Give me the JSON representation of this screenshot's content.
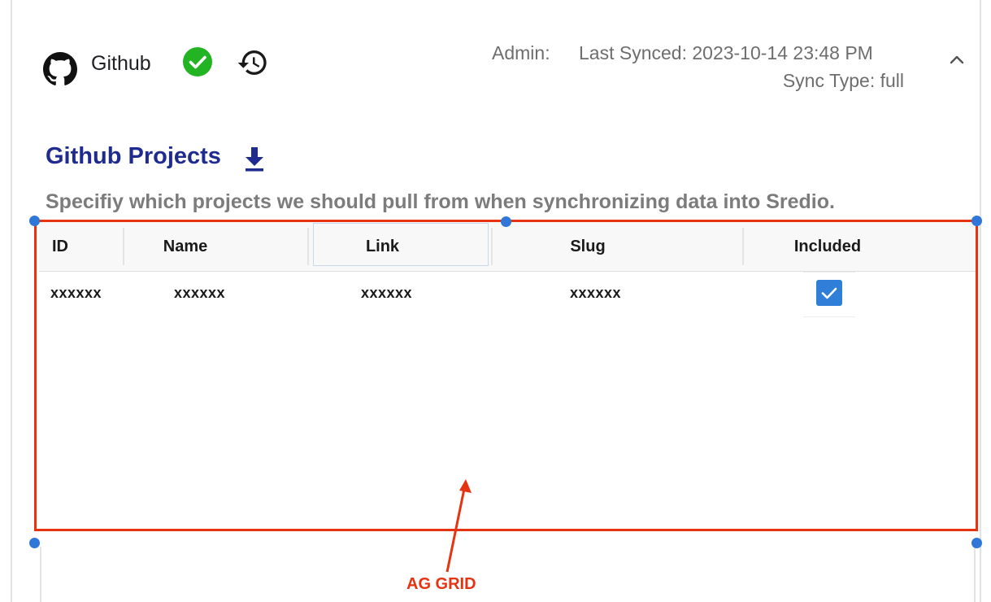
{
  "header": {
    "app_name": "Github",
    "admin_label": "Admin:",
    "last_synced": "Last Synced: 2023-10-14 23:48 PM",
    "sync_type": "Sync Type: full"
  },
  "section": {
    "title": "Github Projects",
    "description": "Specifiy which projects we should pull from when synchronizing data into Sredio."
  },
  "grid": {
    "columns": [
      "ID",
      "Name",
      "Link",
      "Slug",
      "Included"
    ],
    "rows": [
      {
        "id": "xxxxxx",
        "name": "xxxxxx",
        "link": "xxxxxx",
        "slug": "xxxxxx",
        "included": true
      }
    ]
  },
  "annotation": {
    "label": "AG GRID"
  },
  "icons": {
    "brand": "github-icon",
    "status": "check-circle-icon",
    "history": "history-icon",
    "collapse": "chevron-up-icon",
    "download": "download-icon"
  },
  "colors": {
    "title": "#1f2b8f",
    "success": "#22b422",
    "checkbox": "#2f7fd8",
    "annotation": "#e63312",
    "handle": "#2e77d8"
  }
}
